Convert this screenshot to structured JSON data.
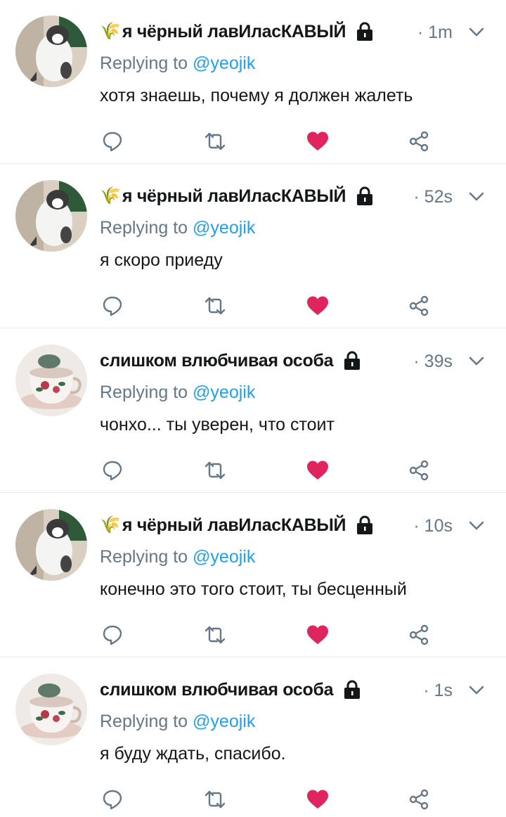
{
  "tweets": [
    {
      "author": "я чёрный лавИласКАВЫЙ",
      "emoji": "🌾",
      "time": "· 1m",
      "reply_prefix": "Replying to ",
      "reply_handle": "@yeojik",
      "text": "хотя знаешь, почему я должен жалеть",
      "avatar": "cat-avatar"
    },
    {
      "author": "я чёрный лавИласКАВЫЙ",
      "emoji": "🌾",
      "time": "· 52s",
      "reply_prefix": "Replying to ",
      "reply_handle": "@yeojik",
      "text": "я скоро приеду",
      "avatar": "cat-avatar"
    },
    {
      "author": "слишком влюбчивая особа",
      "emoji": "",
      "time": "· 39s",
      "reply_prefix": "Replying to ",
      "reply_handle": "@yeojik",
      "text": "чонхо... ты уверен, что стоит",
      "avatar": "teacup-avatar"
    },
    {
      "author": "я чёрный лавИласКАВЫЙ",
      "emoji": "🌾",
      "time": "· 10s",
      "reply_prefix": "Replying to ",
      "reply_handle": "@yeojik",
      "text": "конечно это того стоит, ты бесценный",
      "avatar": "cat-avatar"
    },
    {
      "author": "слишком влюбчивая особа",
      "emoji": "",
      "time": "· 1s",
      "reply_prefix": "Replying to ",
      "reply_handle": "@yeojik",
      "text": "я буду ждать, спасибо.",
      "avatar": "teacup-avatar"
    }
  ],
  "icons": {
    "reply": "reply-icon",
    "retweet": "retweet-icon",
    "like": "heart-icon",
    "share": "share-icon",
    "protected": "lock-icon",
    "more": "chevron-down-icon"
  },
  "colors": {
    "like": "#e0245e",
    "link": "#1da1f2",
    "muted": "#657786",
    "icon": "#657786",
    "text": "#14171a"
  }
}
